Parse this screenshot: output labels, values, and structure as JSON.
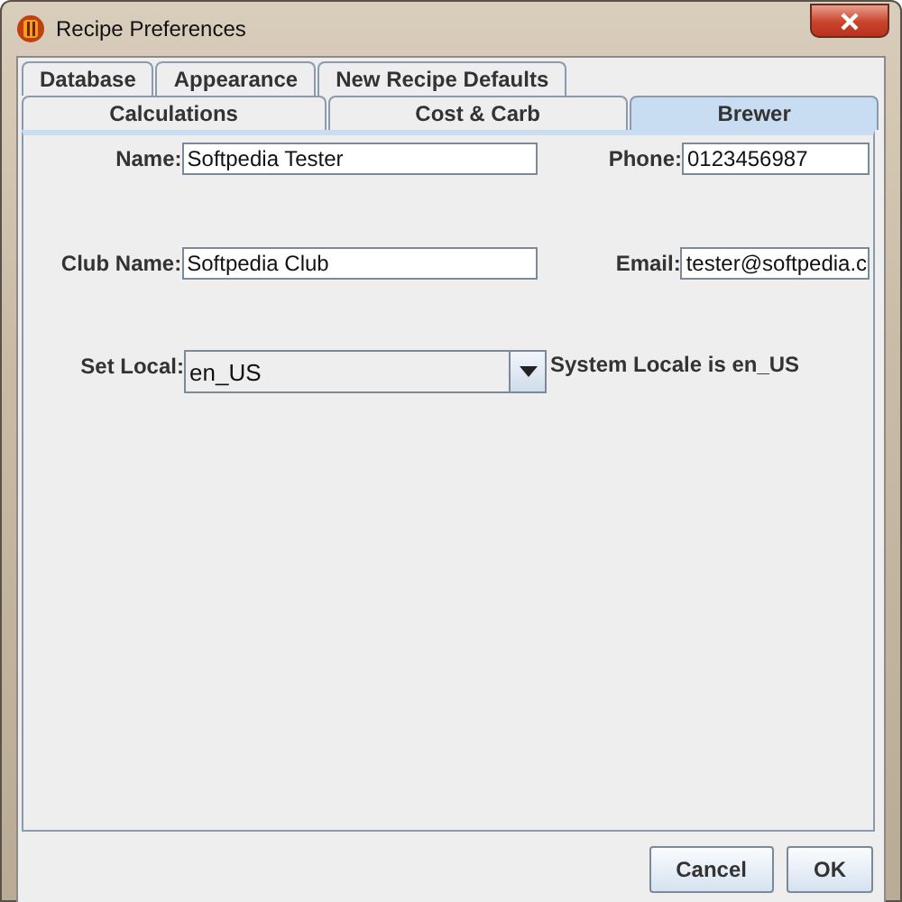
{
  "window": {
    "title": "Recipe Preferences"
  },
  "tab_rows": [
    [
      {
        "label": "Database",
        "selected": false
      },
      {
        "label": "Appearance",
        "selected": false
      },
      {
        "label": "New Recipe Defaults",
        "selected": false
      }
    ],
    [
      {
        "label": "Calculations",
        "selected": false
      },
      {
        "label": "Cost & Carb",
        "selected": false
      },
      {
        "label": "Brewer",
        "selected": true
      }
    ]
  ],
  "form_rows": [
    {
      "fields": [
        {
          "label": "Name:",
          "value": "Softpedia Tester"
        },
        {
          "label": "Phone:",
          "value": "0123456987"
        }
      ]
    },
    {
      "fields": [
        {
          "label": "Club Name:",
          "value": "Softpedia Club"
        },
        {
          "label": "Email:",
          "value": "tester@softpedia.c"
        }
      ]
    }
  ],
  "locale": {
    "label": "Set Local:",
    "value": "en_US",
    "note": "System Locale is en_US"
  },
  "buttons": [
    "Cancel",
    "OK"
  ]
}
